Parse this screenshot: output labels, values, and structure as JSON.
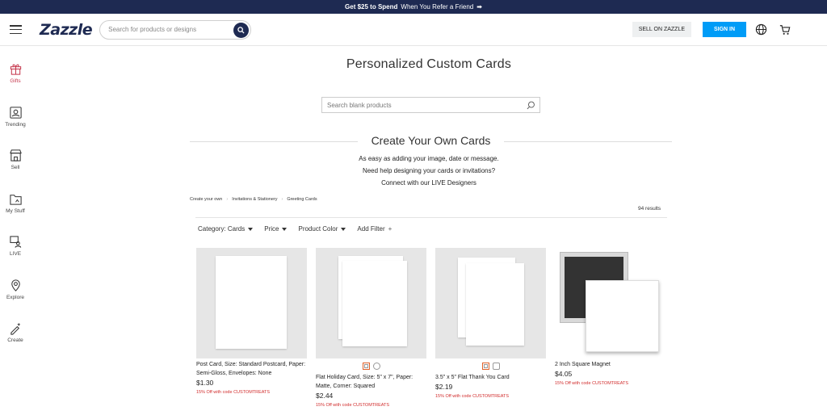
{
  "promo": {
    "bold": "Get $25 to Spend",
    "rest": "When You Refer a Friend",
    "arrow": "➡"
  },
  "header": {
    "logo": "Zazzle",
    "search_placeholder": "Search for products or designs",
    "sell_label": "SELL ON ZAZZLE",
    "signin_label": "SIGN IN"
  },
  "sidebar": {
    "items": [
      {
        "label": "Gifts",
        "icon": "gift-icon"
      },
      {
        "label": "Trending",
        "icon": "trending-icon"
      },
      {
        "label": "Sell",
        "icon": "store-icon"
      },
      {
        "label": "My Stuff",
        "icon": "folder-icon"
      },
      {
        "label": "LIVE",
        "icon": "live-icon"
      },
      {
        "label": "Explore",
        "icon": "explore-icon"
      },
      {
        "label": "Create",
        "icon": "create-icon"
      }
    ]
  },
  "main": {
    "title": "Personalized Custom Cards",
    "blank_search_placeholder": "Search blank products",
    "section_title": "Create Your Own Cards",
    "desc": [
      "As easy as adding your image, date or message.",
      "Need help designing your cards or invitations?",
      "Connect with our LIVE Designers"
    ],
    "breadcrumb": [
      "Create your own",
      "Invitations & Stationery",
      "Greeting Cards"
    ],
    "results": "94 results",
    "filters": [
      "Category: Cards",
      "Price",
      "Product Color",
      "Add Filter"
    ]
  },
  "products": [
    {
      "name": "Post Card, Size: Standard Postcard, Paper: Semi-Gloss, Envelopes: None",
      "price": "$1.30",
      "promo": "15% Off with code CUSTOMTREATS"
    },
    {
      "name": "Flat Holiday Card, Size: 5\" x 7\", Paper: Matte, Corner: Squared",
      "price": "$2.44",
      "promo": "15% Off with code CUSTOMTREATS"
    },
    {
      "name": "3.5\" x 5\" Flat Thank You Card",
      "price": "$2.19",
      "promo": "15% Off with code CUSTOMTREATS"
    },
    {
      "name": "2 Inch Square Magnet",
      "price": "$4.05",
      "promo": "15% Off with code CUSTOMTREATS"
    }
  ],
  "colors": {
    "navy": "#1e2a52",
    "signin": "#009cf7",
    "promo_red": "#d12c2c",
    "gifts_accent": "#c63a4f"
  }
}
